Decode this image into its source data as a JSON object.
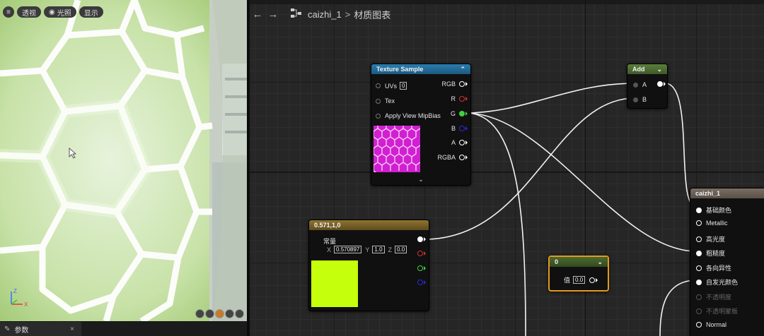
{
  "viewport": {
    "toolbar": {
      "menu_icon": "hamburger-icon",
      "perspective": "透视",
      "lighting": "光照",
      "show": "显示"
    },
    "axis": {
      "z": "Z",
      "x": "X"
    }
  },
  "details_tab": {
    "label": "参数",
    "close": "×"
  },
  "breadcrumb": {
    "back": "←",
    "forward": "→",
    "asset": "caizhi_1",
    "separator": ">",
    "page": "材质图表"
  },
  "nodes": {
    "texture_sample": {
      "title": "Texture Sample",
      "inputs": [
        "UVs",
        "Tex",
        "Apply View MipBias"
      ],
      "uvs_value": "0",
      "outputs": [
        "RGB",
        "R",
        "G",
        "B",
        "A",
        "RGBA"
      ],
      "colors": {
        "header": "#1f5f86",
        "r": "#d23232",
        "g": "#3fd13f",
        "b": "#2b2bd9"
      }
    },
    "add": {
      "title": "Add",
      "inputs": [
        "A",
        "B"
      ],
      "color": "#4c6a32"
    },
    "constant3": {
      "title": "0.571,1,0",
      "label": "常量",
      "x_label": "X",
      "x_value": "0.570897",
      "y_label": "Y",
      "y_value": "1.0",
      "z_label": "Z",
      "z_value": "0.0",
      "swatch": "#c6ff0b",
      "header_color": "#7a6226"
    },
    "constant": {
      "title": "0",
      "label": "值",
      "value": "0.0",
      "border": "#e39a1e"
    },
    "material": {
      "title": "caizhi_1",
      "inputs": [
        "基础颜色",
        "Metallic",
        "高光度",
        "粗糙度",
        "各向异性",
        "自发光颜色",
        "不透明度",
        "不透明蒙板",
        "Normal"
      ],
      "header_color": "#6e6258"
    }
  }
}
